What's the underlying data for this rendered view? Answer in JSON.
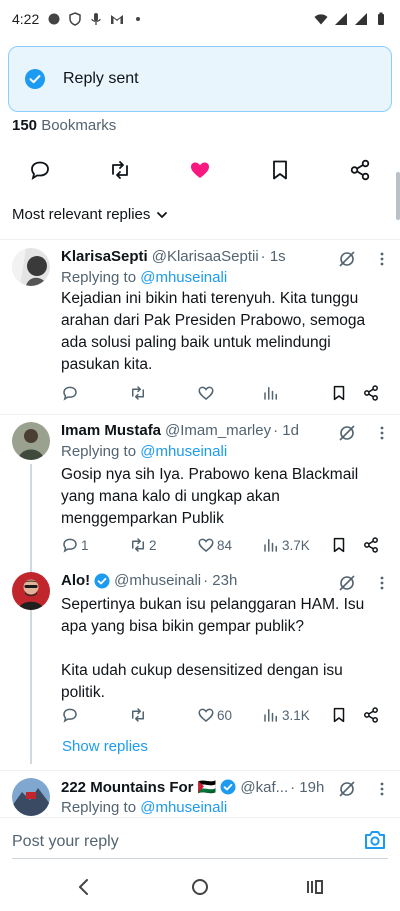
{
  "status_bar": {
    "time": "4:22"
  },
  "toast": {
    "message": "Reply sent"
  },
  "tweet_stats": {
    "bookmarks_count": "150",
    "bookmarks_label": "Bookmarks"
  },
  "sort": {
    "label": "Most relevant replies"
  },
  "replies": [
    {
      "name": "KlarisaSepti",
      "handle": "@KlarisaaSeptii",
      "time": "· 1s",
      "replying_prefix": "Replying to",
      "replying_to": "@mhuseinali",
      "text": "Kejadian ini bikin hati terenyuh. Kita tunggu arahan dari Pak Presiden Prabowo, semoga ada solusi paling baik untuk melindungi pasukan kita.",
      "replies": "",
      "reposts": "",
      "likes": "",
      "views": ""
    },
    {
      "name": "Imam Mustafa",
      "handle": "@Imam_marley",
      "time": "· 1d",
      "replying_prefix": "Replying to",
      "replying_to": "@mhuseinali",
      "text": "Gosip nya sih Iya. Prabowo kena Blackmail yang mana kalo di ungkap akan menggemparkan Publik",
      "replies": "1",
      "reposts": "2",
      "likes": "84",
      "views": "3.7K"
    },
    {
      "name": "Alo!",
      "handle": "@mhuseinali",
      "time": "· 23h",
      "verified": true,
      "text": "Sepertinya bukan isu pelanggaran HAM. Isu apa yang bisa bikin gempar publik?\n\nKita udah cukup desensitized dengan isu politik.",
      "replies": "",
      "reposts": "",
      "likes": "60",
      "views": "3.1K"
    },
    {
      "name": "222 Mountains For 🇵🇸",
      "handle": "@kaf...",
      "time": "· 19h",
      "verified": true,
      "replying_prefix": "Replying to",
      "replying_to": "@mhuseinali"
    }
  ],
  "show_replies": "Show replies",
  "compose": {
    "placeholder": "Post your reply"
  },
  "colors": {
    "accent": "#1d9bf0",
    "like": "#f91880",
    "toast_bg": "#e8f5fd",
    "muted": "#536471"
  }
}
